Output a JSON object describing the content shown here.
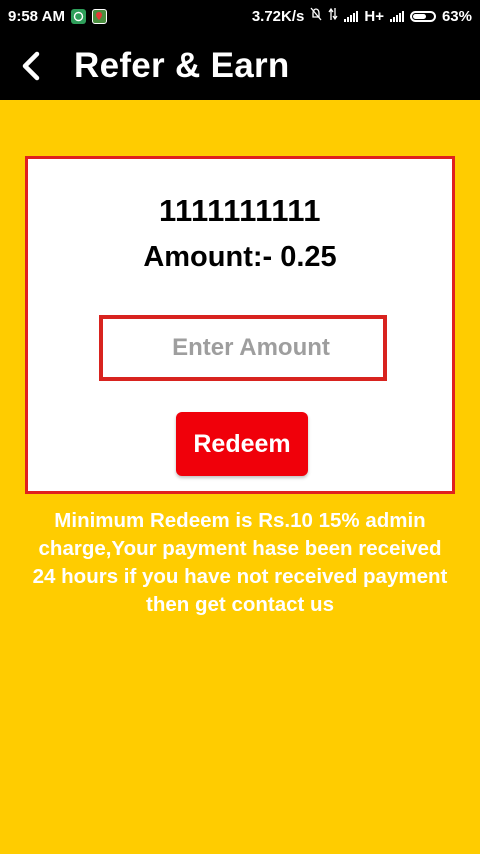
{
  "status_bar": {
    "time": "9:58 AM",
    "network_speed": "3.72K/s",
    "network_type": "H+",
    "battery": "63%",
    "battery_level": 0.63,
    "icons": [
      "whatsapp-icon",
      "maps-icon",
      "mute-icon",
      "data-arrows-icon",
      "signal-icon",
      "battery-icon"
    ]
  },
  "toolbar": {
    "back_icon": "chevron-left-icon",
    "title": "Refer & Earn"
  },
  "card": {
    "account_number": "1111111111",
    "amount_label": "Amount:- 0.25",
    "amount_input": {
      "value": "",
      "placeholder": "Enter Amount"
    },
    "redeem_label": "Redeem"
  },
  "info": {
    "lines": [
      "Minimum Redeem is Rs.10 15% admin",
      "charge,Your payment hase been received",
      "24 hours if you have not received  payment",
      "then get contact us"
    ]
  },
  "colors": {
    "background": "#FFCC00",
    "toolbar": "#000000",
    "card_border": "#E0201E",
    "button": "#F0000A",
    "info_text": "#FFFFFF"
  }
}
